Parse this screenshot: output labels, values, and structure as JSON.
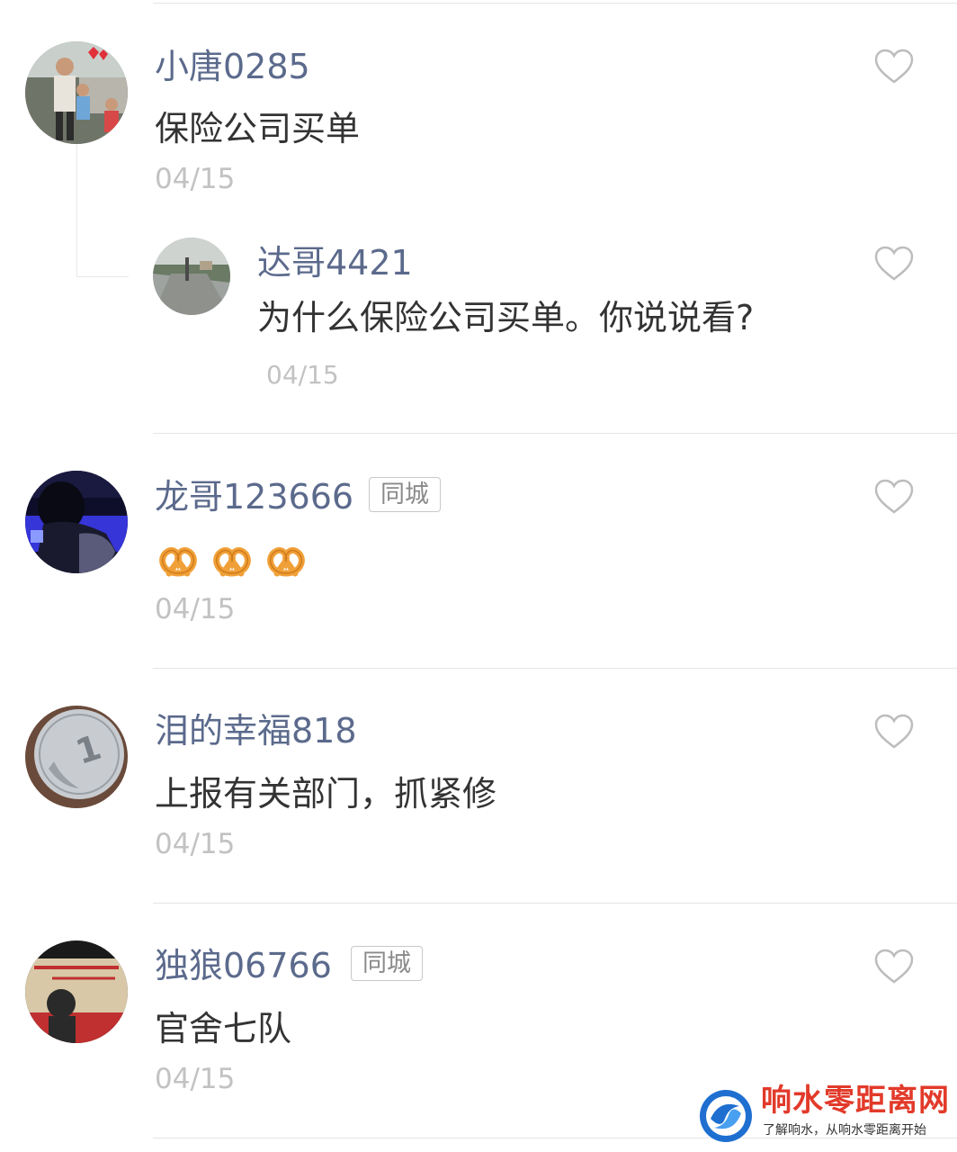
{
  "comments": [
    {
      "username": "小唐0285",
      "text": "保险公司买单",
      "date": "04/15",
      "avatar_icon": "family-photo-avatar",
      "reply": {
        "username": "达哥4421",
        "text": "为什么保险公司买单。你说说看?",
        "date": "04/15",
        "avatar_icon": "road-photo-avatar"
      }
    },
    {
      "username": "龙哥123666",
      "badge": "同城",
      "emojis": [
        "pretzel-emoji",
        "pretzel-emoji",
        "pretzel-emoji"
      ],
      "date": "04/15",
      "avatar_icon": "dark-portrait-avatar"
    },
    {
      "username": "泪的幸福818",
      "text": "上报有关部门，抓紧修",
      "date": "04/15",
      "avatar_icon": "coin-avatar"
    },
    {
      "username": "独狼06766",
      "badge": "同城",
      "text": "官舍七队",
      "date": "04/15",
      "avatar_icon": "poster-avatar"
    }
  ],
  "like_icon": "heart-outline-icon",
  "watermark": {
    "title": "响水零距离网",
    "subtitle": "了解响水，从响水零距离开始"
  },
  "colors": {
    "username": "#5b6a8c",
    "text": "#333333",
    "date": "#c2c2c2",
    "watermark_red": "#e23a2a",
    "watermark_blue": "#1f6fd0"
  }
}
